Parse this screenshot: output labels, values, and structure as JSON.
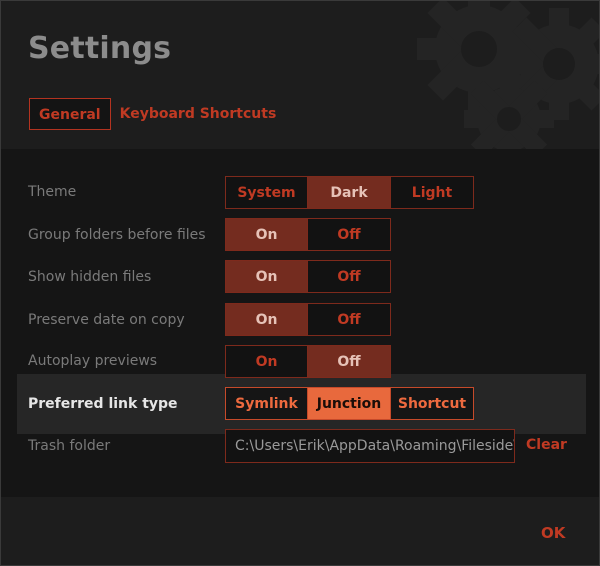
{
  "window": {
    "title": "Settings"
  },
  "tabs": [
    {
      "label": "General",
      "active": true
    },
    {
      "label": "Keyboard Shortcuts",
      "active": false
    }
  ],
  "settings": {
    "theme": {
      "label": "Theme",
      "options": [
        "System",
        "Dark",
        "Light"
      ],
      "selected": "Dark"
    },
    "group_folders": {
      "label": "Group folders before files",
      "options": [
        "On",
        "Off"
      ],
      "selected": "On"
    },
    "hidden_files": {
      "label": "Show hidden files",
      "options": [
        "On",
        "Off"
      ],
      "selected": "On"
    },
    "preserve_date": {
      "label": "Preserve date on copy",
      "options": [
        "On",
        "Off"
      ],
      "selected": "On"
    },
    "autoplay": {
      "label": "Autoplay previews",
      "options": [
        "On",
        "Off"
      ],
      "selected": "Off"
    },
    "link_type": {
      "label": "Preferred link type",
      "options": [
        "Symlink",
        "Junction",
        "Shortcut"
      ],
      "selected": "Junction",
      "highlighted": true
    },
    "trash_folder": {
      "label": "Trash folder",
      "value": "C:\\Users\\Erik\\AppData\\Roaming\\Fileside\\Trash",
      "clear_label": "Clear"
    }
  },
  "footer": {
    "ok_label": "OK"
  },
  "colors": {
    "accent": "#c03a23",
    "accent_bright": "#e8693d",
    "selected_dim": "#742c1f",
    "background": "#1d1d1d"
  },
  "icons": {
    "header_decoration": "gear-icon"
  }
}
